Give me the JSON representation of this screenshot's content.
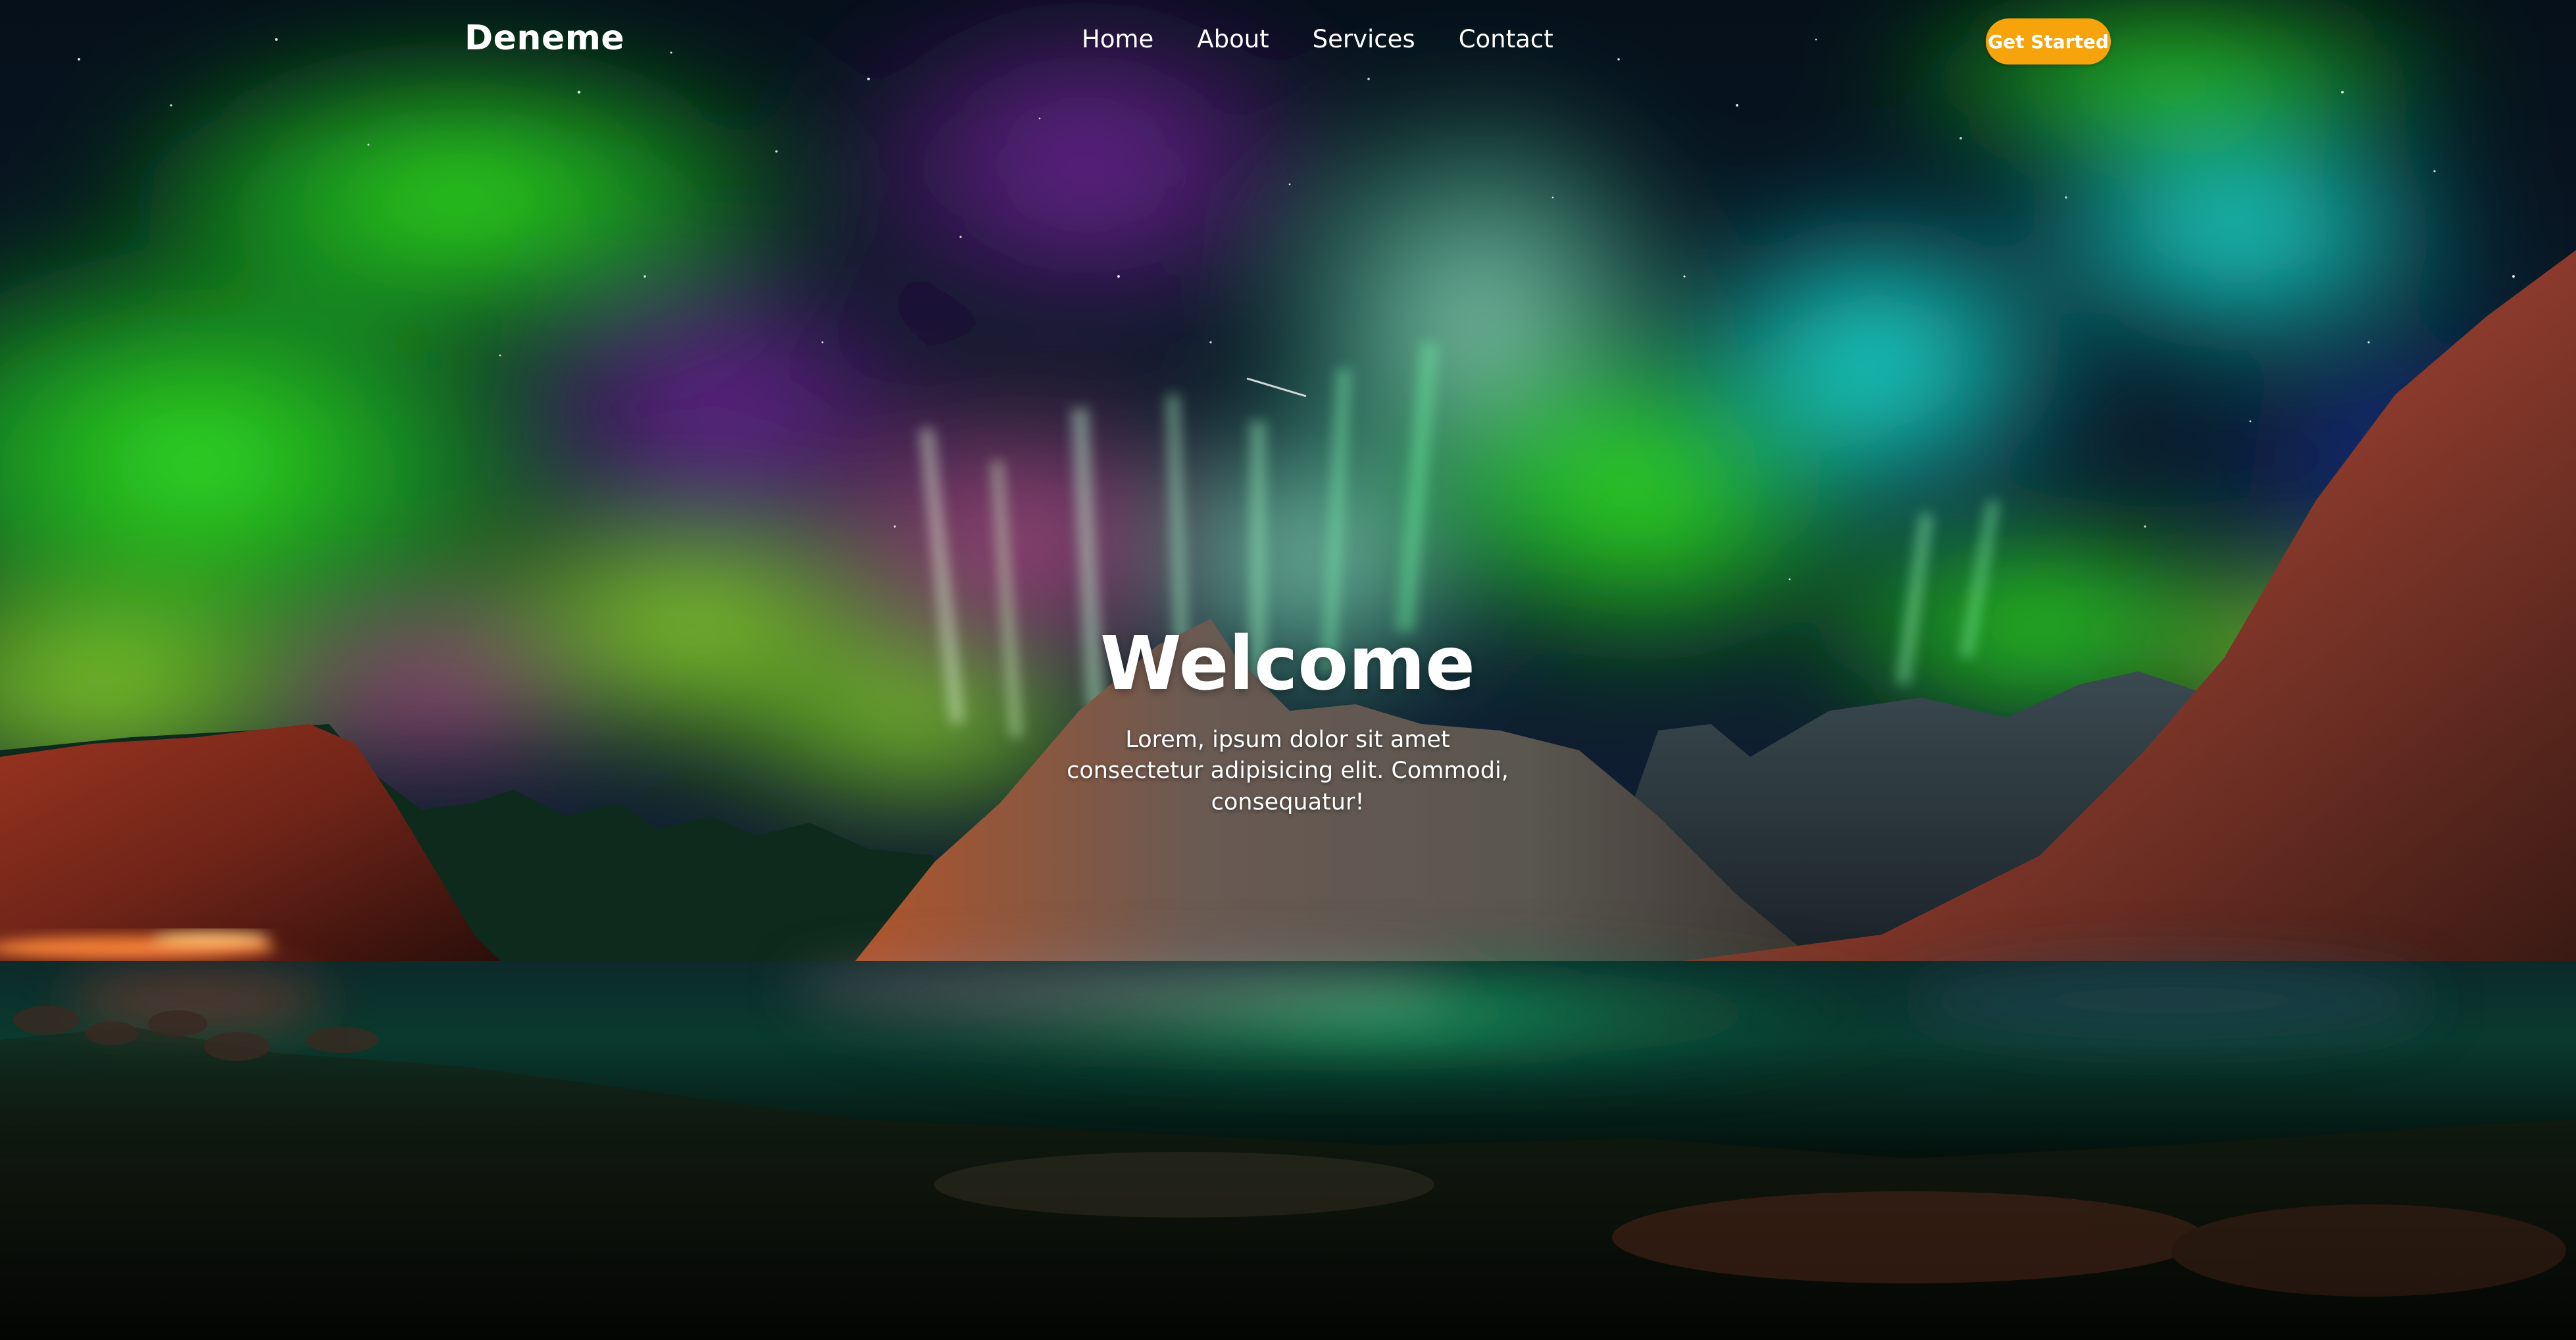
{
  "navbar": {
    "brand": "Deneme",
    "links": [
      {
        "label": "Home"
      },
      {
        "label": "About"
      },
      {
        "label": "Services"
      },
      {
        "label": "Contact"
      }
    ],
    "cta_label": "Get Started"
  },
  "hero": {
    "title": "Welcome",
    "subtitle": "Lorem, ipsum dolor sit amet consectetur adipisicing elit. Commodi, consequatur!",
    "background": "aurora-borealis-over-mountains-and-lake"
  },
  "colors": {
    "accent": "#f7a40c",
    "text": "#ffffff"
  }
}
